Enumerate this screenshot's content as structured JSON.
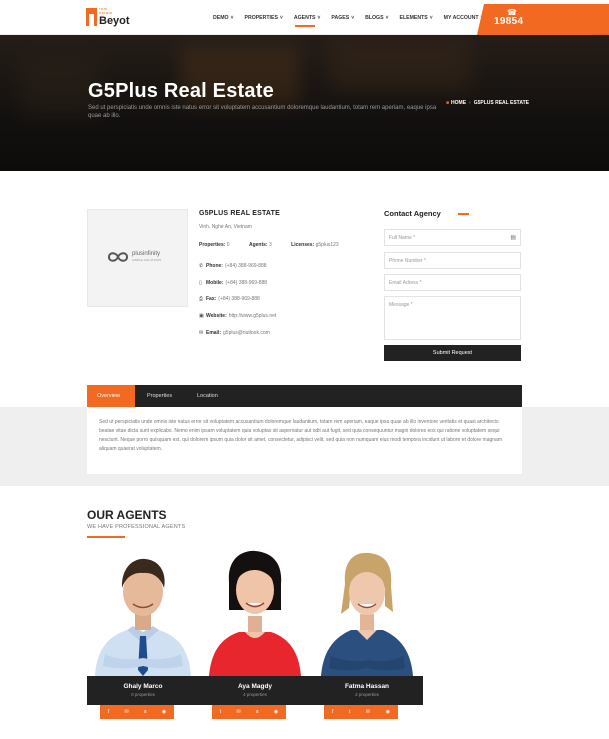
{
  "colors": {
    "accent": "#f26a21",
    "dark": "#222222"
  },
  "header": {
    "logo_small": "real",
    "logo_small2": "estate",
    "logo_name": "Beyot",
    "nav": [
      {
        "label": "DEMO"
      },
      {
        "label": "PROPERTIES"
      },
      {
        "label": "AGENTS"
      },
      {
        "label": "PAGES"
      },
      {
        "label": "BLOGS"
      },
      {
        "label": "ELEMENTS"
      },
      {
        "label": "MY ACCOUNT"
      }
    ],
    "active_nav": "AGENTS",
    "phone": "19854",
    "side_tools": [
      "monitor-icon",
      "gear-icon",
      "heart-icon",
      "target-icon",
      "cart-icon"
    ]
  },
  "hero": {
    "title": "G5Plus Real Estate",
    "text": "Sed ut perspiciatis unde omnis iste natus error sit voluptatem accusantium doloremque laudantium, totam rem aperiam, eaque ipsa quae ab illo.",
    "breadcrumb": {
      "home": "HOME",
      "current": "G5PLUS REAL ESTATE"
    }
  },
  "agency": {
    "logo_text": "plusinfinity",
    "logo_sub": "SIMPLE SOLUTIONS",
    "name": "G5PLUS REAL ESTATE",
    "address": "Vinh, Nghe An, Vietnam",
    "stats": [
      {
        "label": "Properties:",
        "value": "0"
      },
      {
        "label": "Agents:",
        "value": "3"
      },
      {
        "label": "Licenses:",
        "value": "g5plus123"
      }
    ],
    "contacts": [
      {
        "icon": "phone-icon",
        "label": "Phone:",
        "value": "(+84) 388-969-888"
      },
      {
        "icon": "mobile-icon",
        "label": "Mobile:",
        "value": "(+84) 388-969-888"
      },
      {
        "icon": "fax-icon",
        "label": "Fax:",
        "value": "(+84) 388-969-888"
      },
      {
        "icon": "website-icon",
        "label": "Website:",
        "value": "http://www.g5plus.net"
      },
      {
        "icon": "email-icon",
        "label": "Email:",
        "value": "g5plus@outlook.com"
      }
    ]
  },
  "contact_form": {
    "title": "Contact Agency",
    "full_name": "Full Name *",
    "phone": "Phone Number *",
    "email": "Email Adress *",
    "message": "Message *",
    "submit": "Submit Request"
  },
  "tabs": {
    "items": [
      "Overview",
      "Properties",
      "Location"
    ],
    "active": "Overview",
    "overview_text": "Sed ut perspiciatis unde omnis iste natus error sit voluptatem accusantium doloremque laudantium, totam rem aperiam, eaque ipsa quae ab illo inventore veritatis et quasi architecto beatae vitae dicta sunt explicabo. Nemo enim ipsam voluptatem quia voluptas sit aspernatur aut odit aut fugit, sed quia consequuntur magni dolores eos qui ratione voluptatem sequi nesciunt. Neque porro quisquam est, qui dolorem ipsum quia dolor sit amet, consectetur, adipisci velit, sed quia non numquam eius modi tempora incidunt ut labore et dolore magnam aliquam quaerat voluptatem."
  },
  "agents_section": {
    "title": "OUR AGENTS",
    "subtitle": "WE HAVE PROFESSIONAL AGENTS",
    "agents": [
      {
        "name": "Ghaly Marco",
        "properties": "0 properties",
        "shirt": "#cfe0f2",
        "tie": "#1f4d8c",
        "hair": "#3a2a1c",
        "skin": "#e6b99a"
      },
      {
        "name": "Aya Magdy",
        "properties": "4 properties",
        "shirt": "#e8262d",
        "tie": "",
        "hair": "#141010",
        "skin": "#efc4a8"
      },
      {
        "name": "Fatma Hassan",
        "properties": "2 properties",
        "shirt": "#2b4f7e",
        "tie": "",
        "hair": "#c9a46a",
        "skin": "#efc7ac"
      }
    ]
  }
}
